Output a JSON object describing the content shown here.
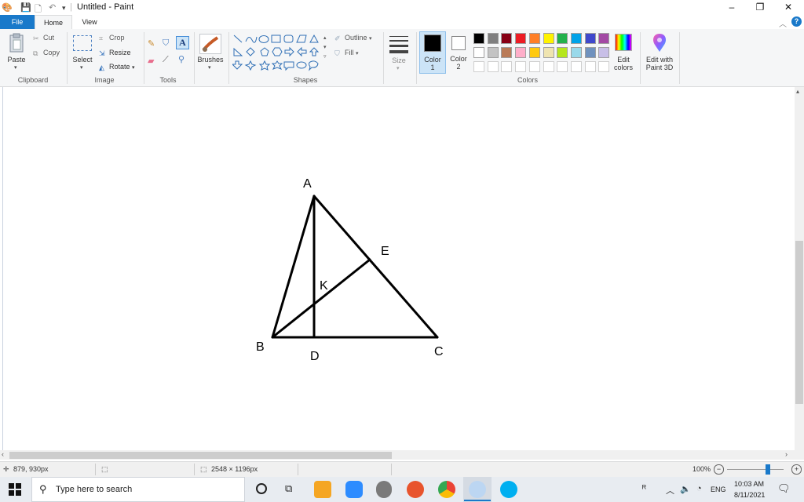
{
  "window": {
    "title": "Untitled - Paint",
    "controls": {
      "minimize": "–",
      "restore": "❐",
      "close": "✕"
    }
  },
  "tabs": {
    "file": "File",
    "home": "Home",
    "view": "View"
  },
  "clipboard": {
    "paste": "Paste",
    "cut": "Cut",
    "copy": "Copy",
    "group": "Clipboard"
  },
  "image": {
    "select": "Select",
    "crop": "Crop",
    "resize": "Resize",
    "rotate": "Rotate",
    "group": "Image"
  },
  "tools": {
    "group": "Tools"
  },
  "brushes": {
    "label": "Brushes"
  },
  "shapes": {
    "outline": "Outline",
    "fill": "Fill",
    "group": "Shapes"
  },
  "size": {
    "label": "Size"
  },
  "colors": {
    "color1_label": "Color",
    "color1_num": "1",
    "color2_label": "Color",
    "color2_num": "2",
    "edit_colors_line1": "Edit",
    "edit_colors_line2": "colors",
    "group": "Colors",
    "row1": [
      "#000000",
      "#7f7f7f",
      "#880015",
      "#ed1c24",
      "#ff7f27",
      "#fff200",
      "#22b14c",
      "#00a2e8",
      "#3f48cc",
      "#a349a4"
    ],
    "row2": [
      "#ffffff",
      "#c3c3c3",
      "#b97a57",
      "#ffaec9",
      "#ffc90e",
      "#efe4b0",
      "#b5e61d",
      "#99d9ea",
      "#7092be",
      "#c8bfe7"
    ],
    "row3": [
      "#ffffff",
      "#ffffff",
      "#ffffff",
      "#ffffff",
      "#ffffff",
      "#ffffff",
      "#ffffff",
      "#ffffff",
      "#ffffff",
      "#ffffff"
    ],
    "color1_value": "#000000",
    "color2_value": "#ffffff"
  },
  "paint3d": {
    "line1": "Edit with",
    "line2": "Paint 3D"
  },
  "drawing": {
    "labels": {
      "A": "A",
      "B": "B",
      "C": "C",
      "D": "D",
      "E": "E",
      "K": "K"
    }
  },
  "status": {
    "cursor": "879, 930px",
    "selection": "",
    "canvas_size": "2548 × 1196px",
    "zoom": "100%",
    "zoom_fraction": 0.72
  },
  "taskbar": {
    "search_placeholder": "Type here to search",
    "lang": "ENG",
    "time": "10:03 AM",
    "date": "8/11/2021"
  }
}
